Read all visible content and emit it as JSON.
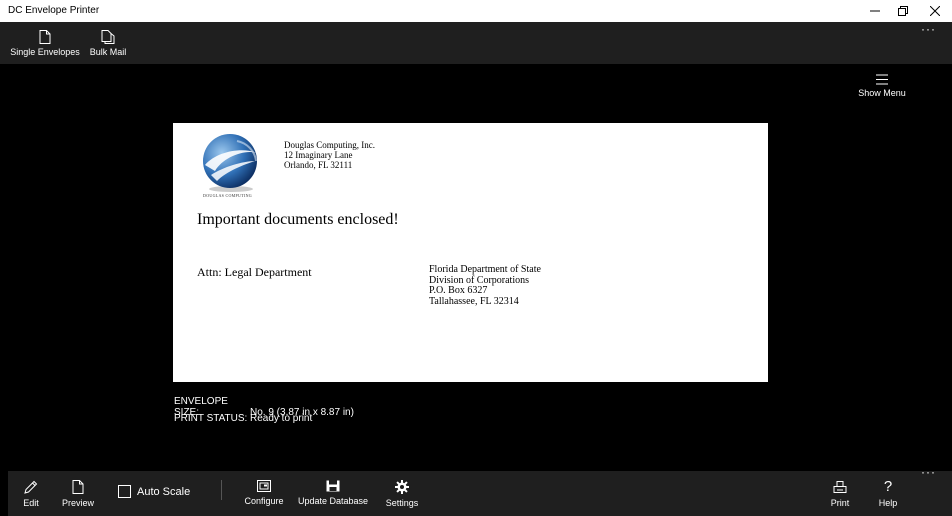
{
  "window": {
    "title": "DC Envelope Printer"
  },
  "topbar": {
    "items": [
      {
        "label": "Single Envelopes",
        "icon": "document-icon"
      },
      {
        "label": "Bulk Mail",
        "icon": "documents-icon"
      }
    ],
    "more": "···"
  },
  "show_menu": {
    "label": "Show Menu",
    "icon": "hamburger-icon"
  },
  "envelope": {
    "logo_text": "DOUGLAS COMPUTING",
    "return_address": [
      "Douglas Computing, Inc.",
      "12 Imaginary Lane",
      "Orlando, FL 32111"
    ],
    "note": "Important documents enclosed!",
    "attention": "Attn: Legal Department",
    "recipient": [
      "Florida Department of State",
      "Division of Corporations",
      "P.O. Box 6327",
      "Tallahassee, FL 32314"
    ]
  },
  "info": {
    "size_label": "ENVELOPE SIZE:",
    "size_value": "No. 9  (3.87 in x 8.87 in)",
    "status_label": "PRINT STATUS:",
    "status_value": "Ready to print"
  },
  "bottombar": {
    "edit": "Edit",
    "preview": "Preview",
    "auto_scale": "Auto Scale",
    "auto_scale_checked": false,
    "configure": "Configure",
    "update_database": "Update Database",
    "settings": "Settings",
    "print": "Print",
    "help": "Help",
    "more": "···"
  }
}
